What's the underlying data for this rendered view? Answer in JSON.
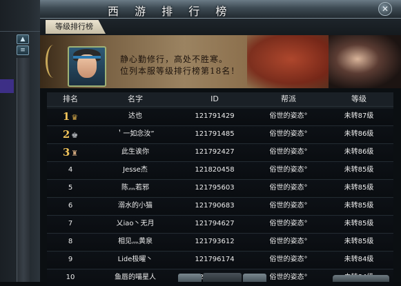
{
  "window": {
    "title": "西 游 排 行 榜",
    "close_symbol": "✕"
  },
  "tab": {
    "label": "等级排行榜"
  },
  "banner": {
    "line1": "静心勤修行，高处不胜寒。",
    "line2": "位列本服等级排行榜第18名！"
  },
  "table": {
    "headers": [
      "排名",
      "名字",
      "ID",
      "帮派",
      "等级"
    ],
    "rows": [
      {
        "rank": "1",
        "name": "达也",
        "id": "121791429",
        "clan": "俗世的姿态°",
        "level": "未转87级"
      },
      {
        "rank": "2",
        "name": "＇一如念汝”",
        "id": "121791485",
        "clan": "俗世的姿态°",
        "level": "未转86级"
      },
      {
        "rank": "3",
        "name": "此生诶你",
        "id": "121792427",
        "clan": "俗世的姿态°",
        "level": "未转86级"
      },
      {
        "rank": "4",
        "name": "Jesse杰",
        "id": "121820458",
        "clan": "俗世的姿态°",
        "level": "未转85级"
      },
      {
        "rank": "5",
        "name": "陈灬若邪",
        "id": "121795603",
        "clan": "俗世的姿态°",
        "level": "未转85级"
      },
      {
        "rank": "6",
        "name": "溺水的小猫",
        "id": "121790683",
        "clan": "俗世的姿态°",
        "level": "未转85级"
      },
      {
        "rank": "7",
        "name": "乂iao丶无月",
        "id": "121794627",
        "clan": "俗世的姿态°",
        "level": "未转85级"
      },
      {
        "rank": "8",
        "name": "相见灬黄泉",
        "id": "121793612",
        "clan": "俗世的姿态°",
        "level": "未转85级"
      },
      {
        "rank": "9",
        "name": "Lide极曜丶",
        "id": "121796174",
        "clan": "俗世的姿态°",
        "level": "未转84级"
      },
      {
        "rank": "10",
        "name": "鱼唇的喵星人",
        "id": "121790955",
        "clan": "俗世的姿态°",
        "level": "未转84级"
      }
    ]
  },
  "colors": {
    "gold": "#f0c35a",
    "tab_bg": "#eae3d0",
    "row_bg": "#0d1116"
  },
  "icons": {
    "medal_1": "crown-medal-icon",
    "medal_2": "crown-medal-icon",
    "medal_3": "crown-medal-icon"
  }
}
